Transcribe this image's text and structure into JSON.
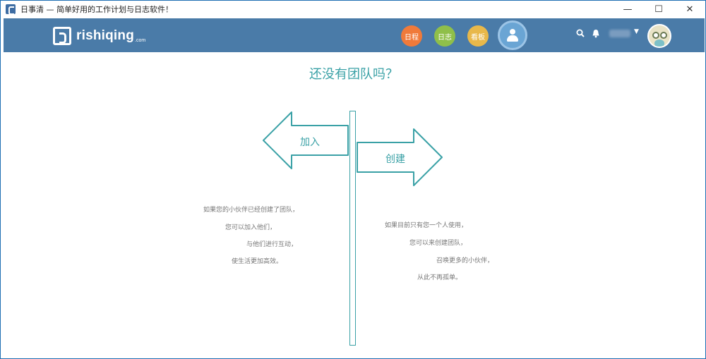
{
  "window": {
    "title": "日事清 — 简单好用的工作计划与日志软件！",
    "controls": {
      "minimize": "—",
      "maximize": "☐",
      "close": "✕"
    }
  },
  "header": {
    "logo_text": "rishiqing",
    "logo_suffix": ".com",
    "nav": [
      {
        "label": "日程",
        "color": "#f07a3a"
      },
      {
        "label": "日志",
        "color": "#8fbf4a"
      },
      {
        "label": "看板",
        "color": "#e8b84a"
      }
    ],
    "team_icon": "team-person-icon",
    "icons": {
      "search": "search-icon",
      "bell": "bell-icon",
      "caret": "caret-down-icon"
    },
    "accent": "#4a7ba8"
  },
  "main": {
    "title": "还没有团队吗？",
    "join": {
      "label": "加入",
      "lines": [
        "如果您的小伙伴已经创建了团队，",
        "您可以加入他们，",
        "与他们进行互动，",
        "使生活更加高效。"
      ]
    },
    "create": {
      "label": "创建",
      "lines": [
        "如果目前只有您一个人使用，",
        "您可以来创建团队，",
        "召唤更多的小伙伴，",
        "从此不再孤单。"
      ]
    },
    "accent": "#3aa1a6"
  }
}
